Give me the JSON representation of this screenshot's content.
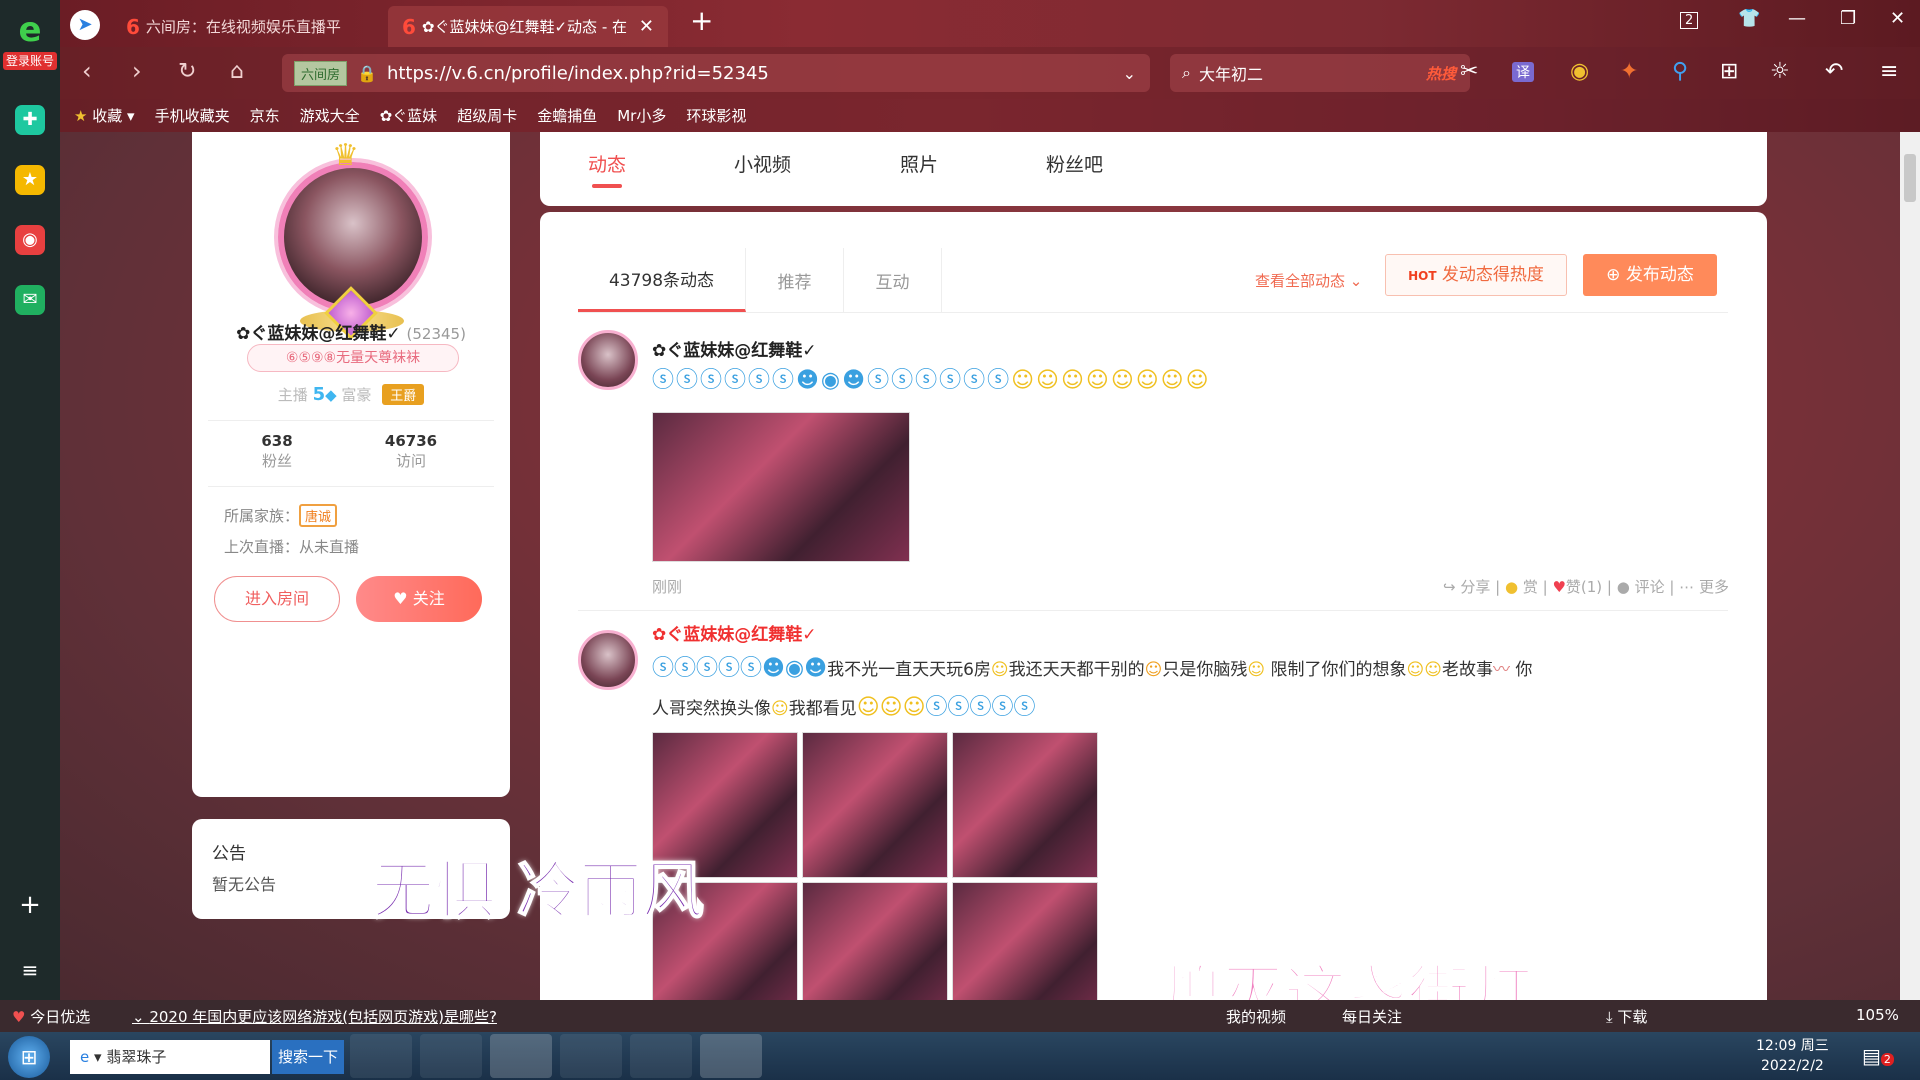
{
  "browser": {
    "tabs": [
      {
        "label": "六间房：在线视频娱乐直播平",
        "active": false
      },
      {
        "label": "✿ぐ蓝妹妹@红舞鞋✓动态 - 在",
        "active": true
      }
    ],
    "new_tab": "+",
    "tab_count": "2",
    "url_site_badge": "六间房",
    "url": "https://v.6.cn/profile/index.php?rid=52345",
    "search_text": "大年初二",
    "search_hot": "热搜",
    "translate_label": "译",
    "bookmarks": [
      "收藏",
      "手机收藏夹",
      "京东",
      "游戏大全",
      "✿ぐ蓝妹",
      "超级周卡",
      "金蟾捕鱼",
      "Mr小多",
      "环球影视"
    ]
  },
  "sidebar": {
    "login_label": "登录账号"
  },
  "profile": {
    "name": "✿ぐ蓝妹妹@红舞鞋✓",
    "rid": "(52345)",
    "medal": "⑥⑤⑨⑧无量天尊袜袜",
    "anchor_label": "主播",
    "anchor_level": "5",
    "rich_label": "富豪",
    "rich_badge": "王爵",
    "fans_count": "638",
    "fans_label": "粉丝",
    "visits_count": "46736",
    "visits_label": "访问",
    "family_label": "所属家族：",
    "family_value": "唐诚",
    "last_live": "上次直播：从未直播",
    "enter_room": "进入房间",
    "follow": "关注"
  },
  "notice": {
    "title": "公告",
    "body": "暂无公告"
  },
  "profile_tabs": [
    "动态",
    "小视频",
    "照片",
    "粉丝吧"
  ],
  "feed": {
    "tabs": [
      "43798条动态",
      "推荐",
      "互动"
    ],
    "view_all": "查看全部动态",
    "hot_button": "发动态得热度",
    "hot_badge": "HOT",
    "post_button": "发布动态",
    "posts": [
      {
        "user": "✿ぐ蓝妹妹@红舞鞋✓",
        "time": "刚刚",
        "actions": [
          "分享",
          "赏",
          "赞(1)",
          "评论",
          "更多"
        ]
      },
      {
        "user": "✿ぐ蓝妹妹@红舞鞋✓",
        "text_a": "我不光一直天天玩6房",
        "text_b": "我还天天都干别的",
        "text_c": "只是你脑残",
        "text_d": "限制了你们的想象",
        "text_e": "老故事",
        "text_f": "你",
        "text_g": "人哥突然换头像",
        "text_h": "我都看见"
      }
    ]
  },
  "overlays": {
    "left": "无惧  冷雨风",
    "right": "熄灭这盏街灯"
  },
  "statusbar": {
    "today": "今日优选",
    "news": "2020 年国内更应该网络游戏(包括网页游戏)是哪些?",
    "my_video": "我的视频",
    "daily": "每日关注",
    "download": "下载",
    "zoom": "105%"
  },
  "taskbar": {
    "ie_task": "翡翠珠子",
    "search_btn": "搜索一下",
    "time": "12:09 周三",
    "date": "2022/2/2",
    "notify_count": "2"
  },
  "colors": {
    "accent": "#f05050",
    "orange": "#ff8a5a",
    "browser_bg": "#7a2530"
  }
}
